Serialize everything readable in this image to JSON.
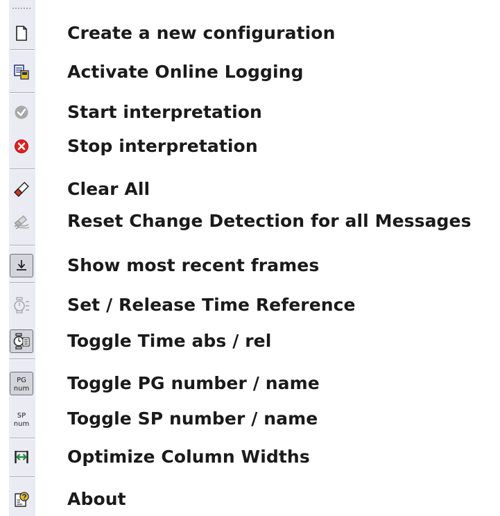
{
  "menu": {
    "items": [
      {
        "id": "create",
        "icon": "new-document-icon",
        "label": "Create a new configuration",
        "enabled": true,
        "checked": false
      },
      {
        "id": "online-logging",
        "icon": "online-logging-icon",
        "label": "Activate Online Logging",
        "enabled": true,
        "checked": false
      },
      {
        "id": "start",
        "icon": "check-circle-icon",
        "label": "Start interpretation",
        "enabled": false,
        "checked": false
      },
      {
        "id": "stop",
        "icon": "stop-circle-icon",
        "label": "Stop interpretation",
        "enabled": true,
        "checked": false
      },
      {
        "id": "clear",
        "icon": "eraser-icon",
        "label": "Clear All",
        "enabled": true,
        "checked": false
      },
      {
        "id": "reset-change",
        "icon": "reset-change-icon",
        "label": "Reset Change Detection for all Messages",
        "enabled": false,
        "checked": false
      },
      {
        "id": "most-recent",
        "icon": "scroll-down-icon",
        "label": "Show most recent frames",
        "enabled": true,
        "checked": true
      },
      {
        "id": "time-ref",
        "icon": "stopwatch-icon",
        "label": "Set / Release Time Reference",
        "enabled": false,
        "checked": false
      },
      {
        "id": "time-abs-rel",
        "icon": "clock-abs-rel-icon",
        "label": "Toggle Time abs / rel",
        "enabled": true,
        "checked": true
      },
      {
        "id": "pg-num",
        "icon": "pg-num-icon",
        "label": "Toggle PG number / name",
        "enabled": true,
        "checked": true
      },
      {
        "id": "sp-num",
        "icon": "sp-num-icon",
        "label": "Toggle SP number / name",
        "enabled": true,
        "checked": false
      },
      {
        "id": "col-widths",
        "icon": "column-width-icon",
        "label": "Optimize Column Widths",
        "enabled": true,
        "checked": false
      },
      {
        "id": "about",
        "icon": "about-help-icon",
        "label": "About",
        "enabled": true,
        "checked": false
      }
    ]
  },
  "icon_text": {
    "pg_top": "PG",
    "pg_bottom": "num",
    "sp_top": "SP",
    "sp_bottom": "num"
  },
  "colors": {
    "toolbar_bg": "#ebebf4",
    "stop_red": "#e02020",
    "disabled_gray": "#a8a8a8",
    "optimize_green": "#1f8a3a"
  }
}
